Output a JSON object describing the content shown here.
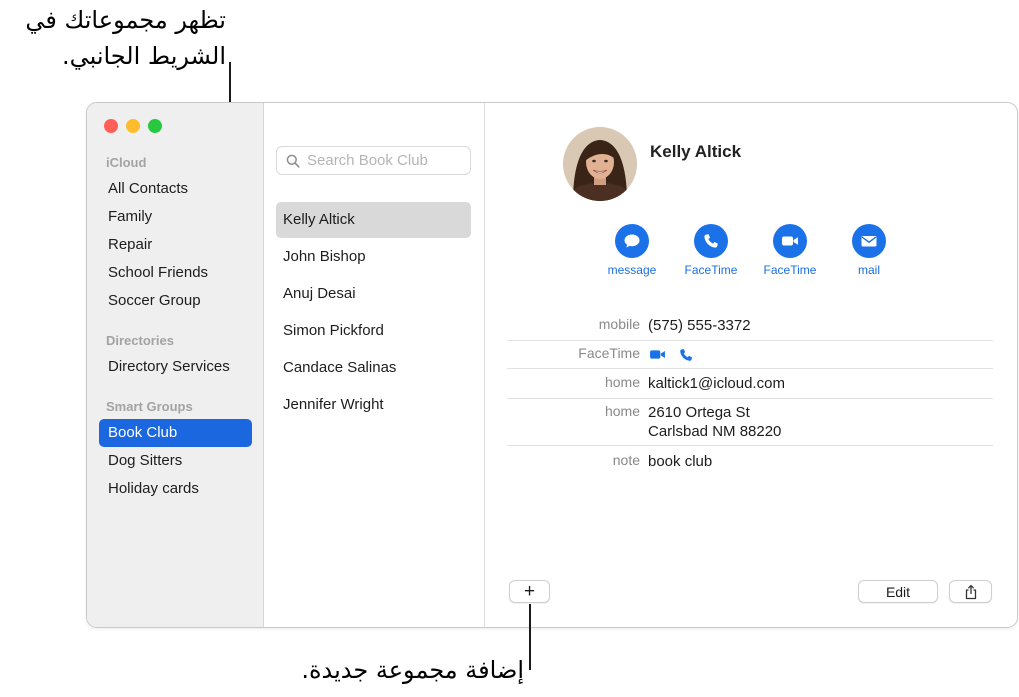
{
  "callouts": {
    "sidebar_groups": "تظهر مجموعاتك في الشريط الجانبي.",
    "add_group": "إضافة مجموعة جديدة."
  },
  "sidebar": {
    "sections": [
      {
        "title": "iCloud",
        "items": [
          "All Contacts",
          "Family",
          "Repair",
          "School Friends",
          "Soccer Group"
        ]
      },
      {
        "title": "Directories",
        "items": [
          "Directory Services"
        ]
      },
      {
        "title": "Smart Groups",
        "items": [
          "Book Club",
          "Dog Sitters",
          "Holiday cards"
        ]
      }
    ],
    "selected_item": "Book Club"
  },
  "search": {
    "placeholder": "Search Book Club",
    "icon": "magnifying-glass-icon"
  },
  "contacts": {
    "items": [
      "Kelly Altick",
      "John Bishop",
      "Anuj Desai",
      "Simon Pickford",
      "Candace Salinas",
      "Jennifer Wright"
    ],
    "selected": "Kelly Altick"
  },
  "detail": {
    "name": "Kelly Altick",
    "actions": [
      {
        "label": "message",
        "icon": "message-bubble-icon"
      },
      {
        "label": "FaceTime",
        "icon": "phone-icon"
      },
      {
        "label": "FaceTime",
        "icon": "video-camera-icon"
      },
      {
        "label": "mail",
        "icon": "envelope-icon"
      }
    ],
    "fields": {
      "mobile": {
        "label": "mobile",
        "value": "(575) 555-3372"
      },
      "facetime": {
        "label": "FaceTime",
        "icons": [
          "video-camera-icon",
          "phone-icon"
        ]
      },
      "email": {
        "label": "home",
        "value": "kaltick1@icloud.com"
      },
      "address": {
        "label": "home",
        "line1": "2610 Ortega St",
        "line2": "Carlsbad NM 88220"
      },
      "note": {
        "label": "note",
        "value": "book club"
      }
    }
  },
  "toolbar": {
    "add_label": "+",
    "edit_label": "Edit",
    "share_icon": "share-icon"
  },
  "colors": {
    "accent": "#1b72e8",
    "selection": "#1a67e0",
    "sidebar_bg": "#efefef"
  }
}
